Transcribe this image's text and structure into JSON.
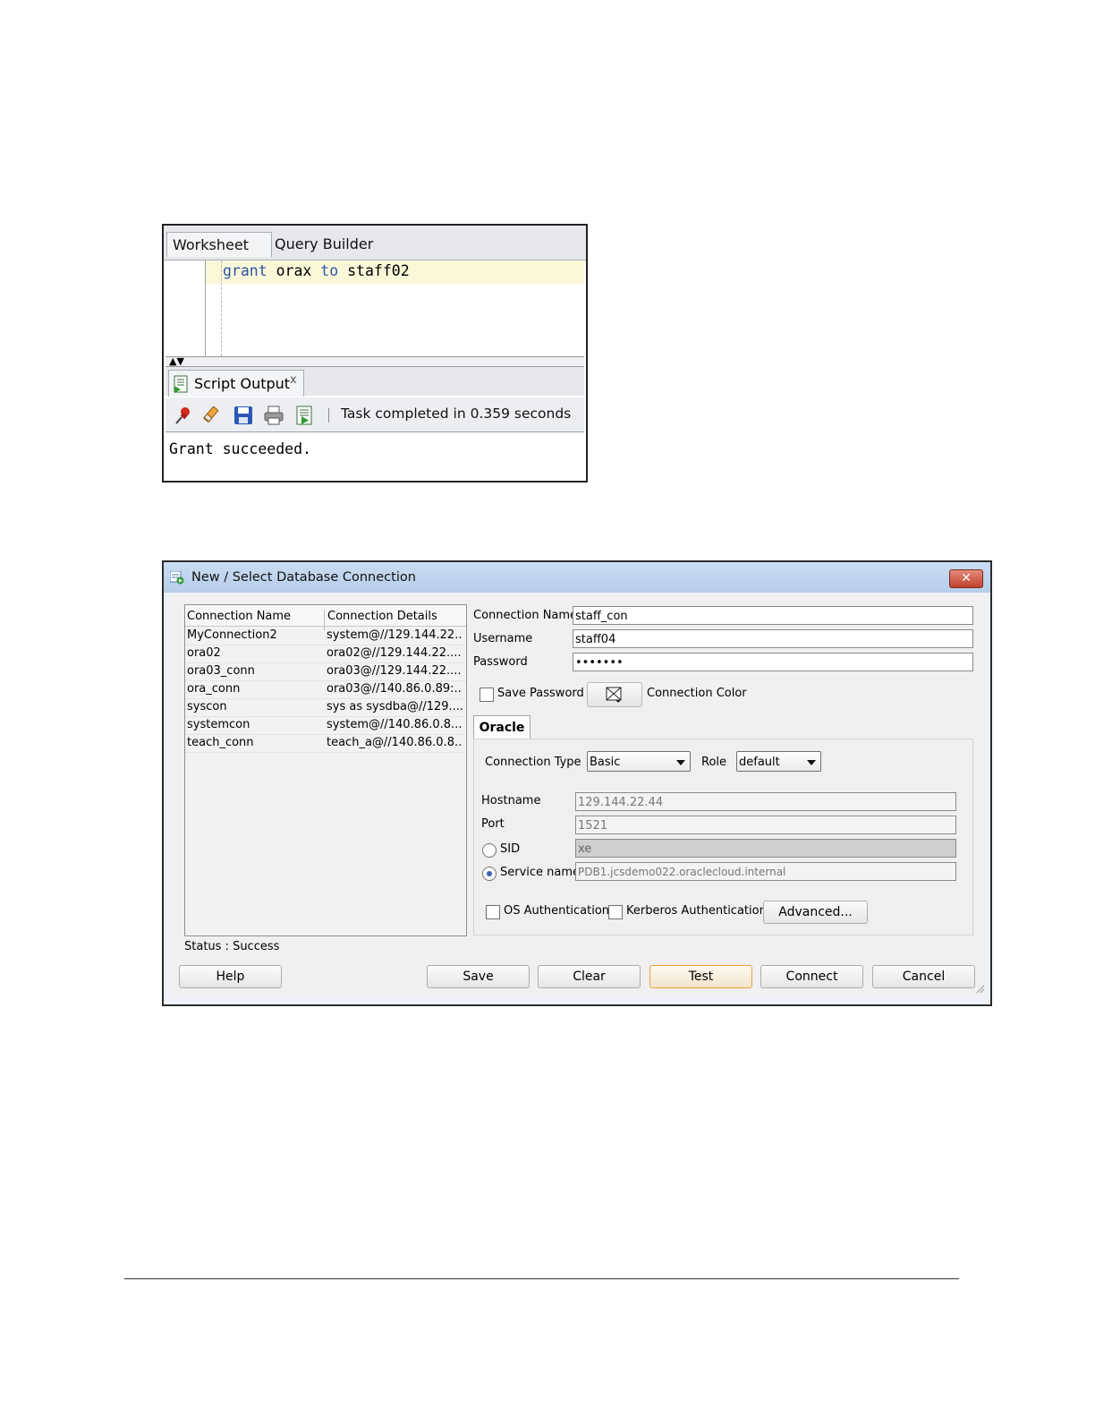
{
  "worksheet": {
    "tabs": [
      "Worksheet",
      "Query Builder"
    ],
    "code": {
      "kw1": "grant",
      "ident1": "orax",
      "kw2": "to",
      "ident2": "staff02"
    },
    "splitter_arrows": "▲▼",
    "output_tab": {
      "label": "Script Output",
      "close": "x"
    },
    "toolbar_icons": [
      "pin-icon",
      "eraser-icon",
      "save-icon",
      "print-icon",
      "run-script-icon"
    ],
    "status": "Task completed in 0.359 seconds",
    "output": "Grant succeeded."
  },
  "dialog": {
    "title": "New / Select Database Connection",
    "close": "✕",
    "list": {
      "headers": [
        "Connection Name",
        "Connection Details"
      ],
      "rows": [
        [
          "MyConnection2",
          "system@//129.144.22..."
        ],
        [
          "ora02",
          "ora02@//129.144.22...."
        ],
        [
          "ora03_conn",
          "ora03@//129.144.22...."
        ],
        [
          "ora_conn",
          "ora03@//140.86.0.89:..."
        ],
        [
          "syscon",
          "sys as sysdba@//129...."
        ],
        [
          "systemcon",
          "system@//140.86.0.8..."
        ],
        [
          "teach_conn",
          "teach_a@//140.86.0.8..."
        ]
      ]
    },
    "status": "Status : Success",
    "form": {
      "connection_name_label": "Connection Name",
      "connection_name": "staff_con",
      "username_label": "Username",
      "username": "staff04",
      "password_label": "Password",
      "password": "•••••••",
      "save_password_label": "Save Password",
      "connection_color_label": "Connection Color",
      "tab": "Oracle",
      "connection_type_label": "Connection Type",
      "connection_type": "Basic",
      "role_label": "Role",
      "role": "default",
      "hostname_label": "Hostname",
      "hostname": "129.144.22.44",
      "port_label": "Port",
      "port": "1521",
      "sid_label": "SID",
      "sid": "xe",
      "service_name_label": "Service name",
      "service_name": "PDB1.jcsdemo022.oraclecloud.internal",
      "os_auth_label": "OS Authentication",
      "kerberos_auth_label": "Kerberos Authentication",
      "advanced_label": "Advanced..."
    },
    "buttons": {
      "help": "Help",
      "save": "Save",
      "clear": "Clear",
      "test": "Test",
      "connect": "Connect",
      "cancel": "Cancel"
    }
  }
}
